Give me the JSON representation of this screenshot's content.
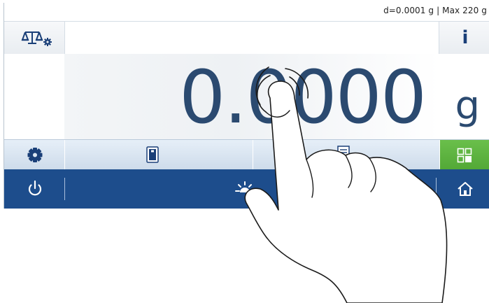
{
  "header": {
    "specs": "d=0.0001 g | Max 220 g"
  },
  "status": {
    "info_glyph": "i"
  },
  "display": {
    "weight": "0.0000",
    "unit": "g"
  },
  "colors": {
    "digits": "#2b4a70",
    "nav_bar": "#1d4d8c",
    "favorites_button": "#52a836",
    "icon_blue": "#1a3f78"
  },
  "icons": {
    "balance_settings": "balance-gear-icon",
    "info": "info-icon",
    "settings": "gear-icon",
    "adjustment": "weight-icon",
    "protocol": "document-icon",
    "favorites": "grid-icon",
    "power": "power-icon",
    "brightness": "brightness-icon",
    "home": "home-icon",
    "gesture": "tap-gesture-hand-icon"
  }
}
